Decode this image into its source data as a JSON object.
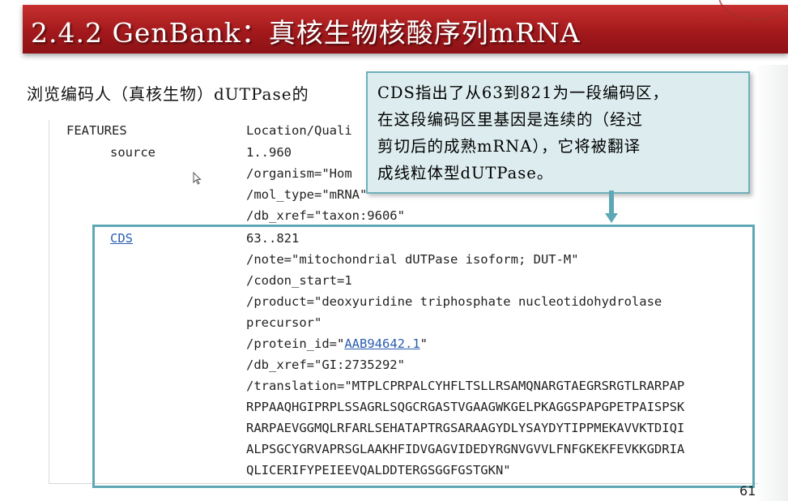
{
  "slide": {
    "title": "2.4.2 GenBank：真核生物核酸序列mRNA",
    "subtitle": "浏览编码人（真核生物）dUTPase的",
    "page_number": "61"
  },
  "callout": {
    "lines": [
      "CDS指出了从63到821为一段编码区，",
      "在这段编码区里基因是连续的（经过",
      "剪切后的成熟mRNA），它将被翻译",
      "成线粒体型dUTPase。"
    ]
  },
  "genbank": {
    "header_left": "FEATURES",
    "header_right": "Location/Quali",
    "source": {
      "key": "source",
      "location": "1..960",
      "qualifiers": [
        "/organism=\"Hom",
        "/mol_type=\"mRNA\"",
        "/db_xref=\"taxon:9606\""
      ]
    },
    "cds": {
      "key": "CDS",
      "location": "63..821",
      "note": "/note=\"mitochondrial dUTPase isoform; DUT-M\"",
      "codon_start": "/codon_start=1",
      "product_1": "/product=\"deoxyuridine triphosphate nucleotidohydrolase",
      "product_2": "precursor\"",
      "protein_id_prefix": "/protein_id=\"",
      "protein_id": "AAB94642.1",
      "protein_id_suffix": "\"",
      "db_xref": "/db_xref=\"GI:2735292\"",
      "translation_prefix": "/translation=\"",
      "translation": [
        "MTPLCPRPALCYHFLTSLLRSAMQNARGTAEGRSRGTLRARPAP",
        "RPPAAQHGIPRPLSSAGRLSQGCRGASTVGAAGWKGELPKAGGSPAPGPETPAISPSK",
        "RARPAEVGGMQLRFARLSEHATAPTRGSARAAGYDLYSAYDYTIPPMEKAVVKTDIQI",
        "ALPSGCYGRVAPRSGLAAKHFIDVGAGVIDEDYRGNVGVVLFNFGKEKFEVKKGDRIA",
        "QLICERIFYPEIEEVQALDDTERGSGGFGSTGKN\""
      ]
    }
  },
  "colors": {
    "title_bar": "#a3191c",
    "callout_bg": "#ddedef",
    "accent_teal": "#5ea8b5",
    "link": "#2a5db0"
  }
}
